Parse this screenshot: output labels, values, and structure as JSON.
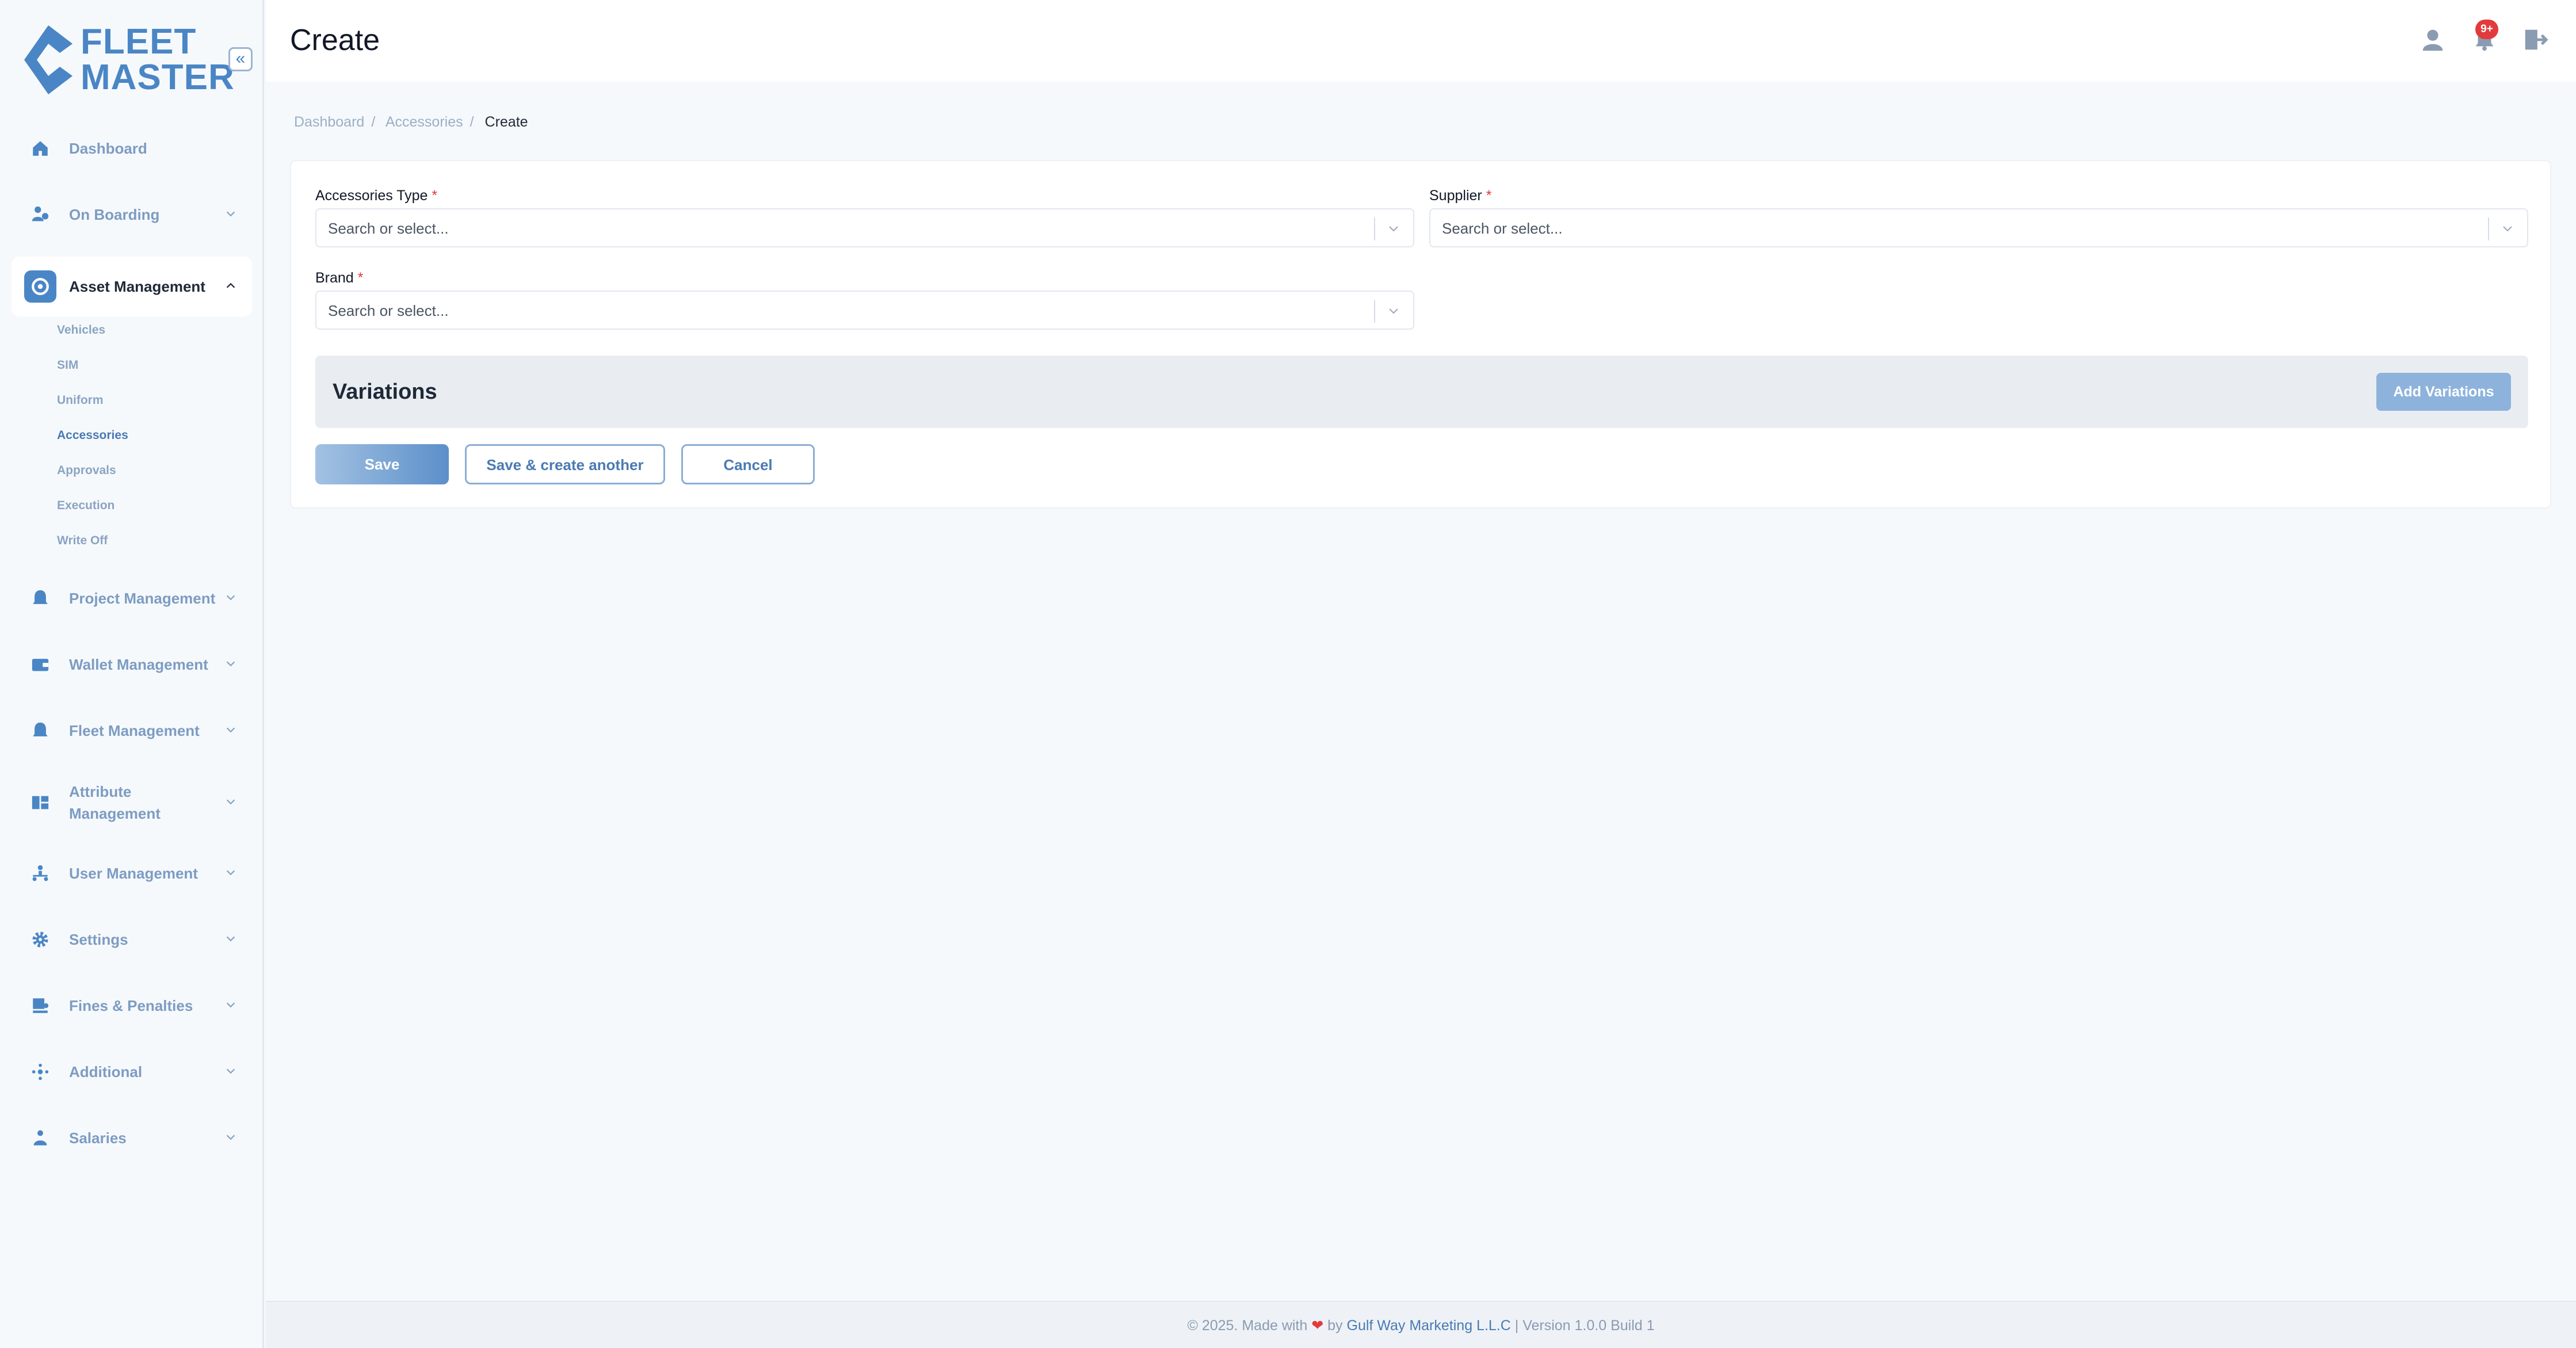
{
  "brand": {
    "logo_line1": "FLEET",
    "logo_line2": "MASTER",
    "color": "#4a86c5"
  },
  "header": {
    "title": "Create",
    "notification_badge": "9+"
  },
  "breadcrumb": [
    "Dashboard",
    "Accessories",
    "Create"
  ],
  "sidebar": {
    "items": [
      {
        "label": "Dashboard",
        "icon": "home-icon"
      },
      {
        "label": "On Boarding",
        "icon": "onboarding-icon"
      },
      {
        "label": "Asset Management",
        "icon": "asset-icon"
      },
      {
        "label": "Project Management",
        "icon": "project-icon"
      },
      {
        "label": "Wallet Management",
        "icon": "wallet-icon"
      },
      {
        "label": "Fleet Management",
        "icon": "fleet-icon"
      },
      {
        "label": "Attribute Management",
        "icon": "attribute-icon"
      },
      {
        "label": "User Management",
        "icon": "users-icon"
      },
      {
        "label": "Settings",
        "icon": "gear-icon"
      },
      {
        "label": "Fines & Penalties",
        "icon": "fines-icon"
      },
      {
        "label": "Additional",
        "icon": "additional-icon"
      },
      {
        "label": "Salaries",
        "icon": "salaries-icon"
      }
    ],
    "asset_sub": [
      "Vehicles",
      "SIM",
      "Uniform",
      "Accessories",
      "Approvals",
      "Execution",
      "Write Off"
    ]
  },
  "form": {
    "accessories_type_label": "Accessories Type",
    "supplier_label": "Supplier",
    "brand_label": "Brand",
    "required_mark": "*",
    "placeholder": "Search or select...",
    "variations_title": "Variations",
    "add_variations": "Add Variations",
    "save": "Save",
    "save_create_another": "Save & create another",
    "cancel": "Cancel"
  },
  "footer": {
    "prefix": "© 2025. Made with",
    "heart": "❤",
    "by": "by",
    "company": "Gulf Way Marketing L.L.C",
    "version": "| Version 1.0.0 Build 1"
  }
}
